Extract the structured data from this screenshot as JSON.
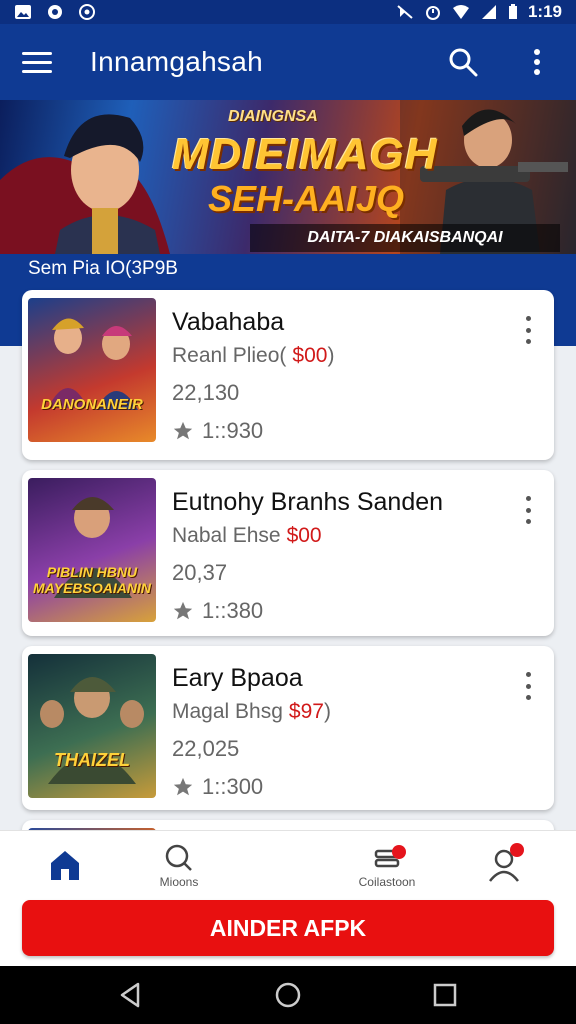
{
  "status_bar": {
    "time": "1:19",
    "left_icons": [
      "image-icon",
      "message-icon",
      "at-icon"
    ],
    "right_icons": [
      "mute-icon",
      "alarm-icon",
      "wifi-icon",
      "signal-icon",
      "battery-icon"
    ]
  },
  "app_bar": {
    "title": "Innamgahsah",
    "menu_icon": "menu-icon",
    "search_icon": "search-icon",
    "more_icon": "more-vertical-icon"
  },
  "banner": {
    "tag": "DIAINGNSA",
    "title_line1": "MDIEIMAGH",
    "title_line2": "SEH-AAIJQ",
    "strip_text": "DAITA-7 DIAKAISBANQAI"
  },
  "section": {
    "label": "Sem Pia IO(3P9B"
  },
  "items": [
    {
      "title": "Vabahaba",
      "subtitle": "Reanl Plieo(",
      "price": "$00",
      "subtitle_suffix": ")",
      "count": "22,130",
      "rating": "1::930",
      "thumb_text": "DANONANEIR",
      "thumb_colors": [
        "#1c3f8a",
        "#c43a2e",
        "#e88a2a"
      ]
    },
    {
      "title": "Eutnohy Branhs Sanden",
      "subtitle": "Nabal Ehse",
      "price": "$00",
      "subtitle_suffix": "",
      "count": "20,37",
      "rating": "1::380",
      "thumb_text": "PIBLIN HBNU MAYEBSOAIANIN",
      "thumb_colors": [
        "#3a1d5e",
        "#8a3fa8",
        "#d8a23a"
      ]
    },
    {
      "title": "Eary Bpaoa",
      "subtitle": "Magal Bhsg",
      "price": "$97",
      "subtitle_suffix": ")",
      "count": "22,025",
      "rating": "1::300",
      "thumb_text": "THAIZEL",
      "thumb_colors": [
        "#14303a",
        "#3d6e52",
        "#c79b3a"
      ]
    }
  ],
  "bottom_nav": {
    "items": [
      {
        "label": "",
        "icon": "home-icon",
        "active": true,
        "badge": false
      },
      {
        "label": "Mioons",
        "icon": "search-icon",
        "active": false,
        "badge": false
      },
      {
        "label": "Coilastoon",
        "icon": "collection-icon",
        "active": false,
        "badge": true
      },
      {
        "label": "",
        "icon": "profile-icon",
        "active": false,
        "badge": true
      }
    ]
  },
  "cta": {
    "label": "AINDER AFPK"
  },
  "colors": {
    "primary": "#0f3a93",
    "accent": "#e81010",
    "price": "#d11a1a"
  }
}
